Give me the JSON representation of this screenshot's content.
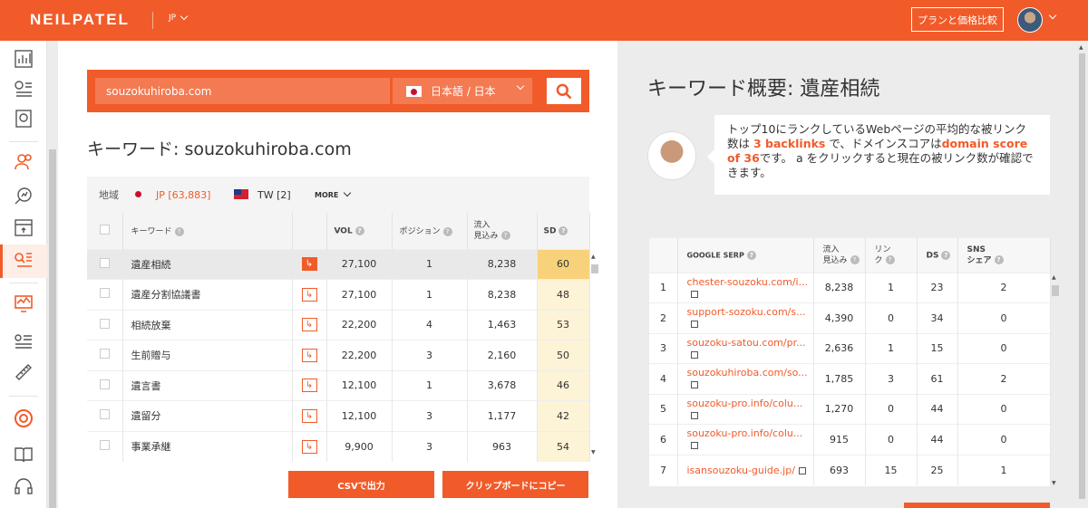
{
  "header": {
    "brand": "NEILPATEL",
    "region": "JP",
    "plan_button": "プランと価格比較"
  },
  "sidebar": {
    "icons": [
      "analytics-icon",
      "list-icon",
      "document-icon",
      "users-icon",
      "search-chart-icon",
      "calendar-icon",
      "keyword-list-icon",
      "monitor-chart-icon",
      "settings-list-icon",
      "ruler-icon",
      "lifebuoy-icon",
      "book-icon",
      "headset-icon"
    ]
  },
  "search": {
    "value": "souzokuhiroba.com",
    "language": "日本語 / 日本"
  },
  "keyword_title": "キーワード: souzokuhiroba.com",
  "regions": {
    "label": "地域",
    "jp": "JP [63,883]",
    "tw": "TW [2]",
    "more": "MORE"
  },
  "keyword_table": {
    "headers": {
      "keyword": "キーワード",
      "vol": "VOL",
      "position": "ポジション",
      "traffic": "流入\n見込み",
      "sd": "SD"
    },
    "rows": [
      {
        "keyword": "遺産相続",
        "vol": "27,100",
        "position": "1",
        "traffic": "8,238",
        "sd": "60"
      },
      {
        "keyword": "遺産分割協議書",
        "vol": "27,100",
        "position": "1",
        "traffic": "8,238",
        "sd": "48"
      },
      {
        "keyword": "相続放棄",
        "vol": "22,200",
        "position": "4",
        "traffic": "1,463",
        "sd": "53"
      },
      {
        "keyword": "生前贈与",
        "vol": "22,200",
        "position": "3",
        "traffic": "2,160",
        "sd": "50"
      },
      {
        "keyword": "遺言書",
        "vol": "12,100",
        "position": "1",
        "traffic": "3,678",
        "sd": "46"
      },
      {
        "keyword": "遺留分",
        "vol": "12,100",
        "position": "3",
        "traffic": "1,177",
        "sd": "42"
      },
      {
        "keyword": "事業承継",
        "vol": "9,900",
        "position": "3",
        "traffic": "963",
        "sd": "54"
      }
    ]
  },
  "buttons": {
    "csv": "CSVで出力",
    "clipboard": "クリップボードにコピー"
  },
  "overview": {
    "title": "キーワード概要: 遺産相続",
    "bubble_part1": "トップ10にランクしているWebページの平均的な被リンク数は ",
    "bubble_backlinks": "3 backlinks",
    "bubble_part2": " で、ドメインスコアは",
    "bubble_domain": "domain score of 36",
    "bubble_part3": "です。 a をクリックすると現在の被リンク数が確認できます。"
  },
  "serp_table": {
    "headers": {
      "serp": "GOOGLE SERP",
      "traffic": "流入\n見込み",
      "links": "リン\nク",
      "ds": "DS",
      "sns": "SNS\nシェア"
    },
    "rows": [
      {
        "rank": "1",
        "url": "chester-souzoku.com/i...",
        "traffic": "8,238",
        "links": "1",
        "ds": "23",
        "sns": "2"
      },
      {
        "rank": "2",
        "url": "support-sozoku.com/s...",
        "traffic": "4,390",
        "links": "0",
        "ds": "34",
        "sns": "0"
      },
      {
        "rank": "3",
        "url": "souzoku-satou.com/pr...",
        "traffic": "2,636",
        "links": "1",
        "ds": "15",
        "sns": "0"
      },
      {
        "rank": "4",
        "url": "souzokuhiroba.com/so...",
        "traffic": "1,785",
        "links": "3",
        "ds": "61",
        "sns": "2"
      },
      {
        "rank": "5",
        "url": "souzoku-pro.info/colu...",
        "traffic": "1,270",
        "links": "0",
        "ds": "44",
        "sns": "0"
      },
      {
        "rank": "6",
        "url": "souzoku-pro.info/colu...",
        "traffic": "915",
        "links": "0",
        "ds": "44",
        "sns": "0"
      },
      {
        "rank": "7",
        "url": "isansouzoku-guide.jp/",
        "traffic": "693",
        "links": "15",
        "ds": "25",
        "sns": "1"
      }
    ]
  },
  "colors": {
    "accent": "#f15b2a",
    "sd_high": "#f8d27a",
    "sd_low": "#fdf3d6"
  }
}
